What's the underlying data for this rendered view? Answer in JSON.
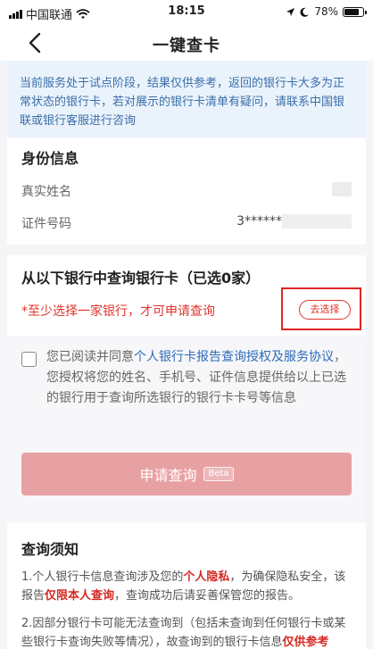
{
  "status_bar": {
    "carrier": "中国联通",
    "time": "18:15",
    "battery": "78%",
    "battery_level": 0.78
  },
  "nav": {
    "title": "一键查卡"
  },
  "notice": {
    "text": "当前服务处于试点阶段，结果仅供参考，返回的银行卡大多为正常状态的银行卡，若对展示的银行卡清单有疑问，请联系中国银联或银行客服进行咨询"
  },
  "identity": {
    "title": "身份信息",
    "name_label": "真实姓名",
    "id_label": "证件号码",
    "id_value": "3******"
  },
  "bank": {
    "title": "从以下银行中查询银行卡（已选0家）",
    "warning": "*至少选择一家银行，才可申请查询",
    "choose_label": "去选择"
  },
  "agreement": {
    "prefix": "您已阅读并同意",
    "link": "个人银行卡报告查询授权及服务协议",
    "suffix": "，您授权将您的姓名、手机号、证件信息提供给以上已选的银行用于查询所选银行的银行卡卡号等信息",
    "apply_label": "申请查询",
    "beta": "Beta"
  },
  "rules": {
    "title": "查询须知",
    "r1_a": "1.个人银行卡信息查询涉及您的",
    "r1_b": "个人隐私",
    "r1_c": "，为确保隐私安全，该报告",
    "r1_d": "仅限本人查询",
    "r1_e": "，查询成功后请妥善保管您的报告。",
    "r2_a": "2.因部分银行卡可能无法查询到（包括未查询到任何银行卡或某些银行卡查询失败等情况），故查询到的银行卡信息",
    "r2_b": "仅供参考"
  }
}
